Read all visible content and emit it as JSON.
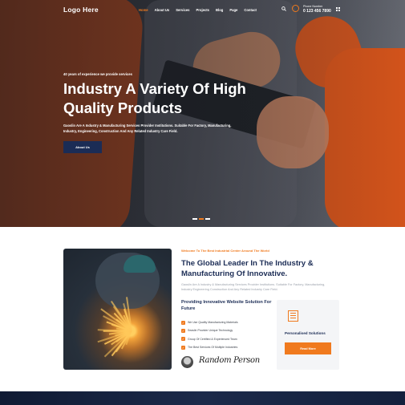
{
  "header": {
    "logo": "Logo Here",
    "nav": [
      "Home",
      "About Us",
      "Services",
      "Projects",
      "Blog",
      "Page",
      "Contact"
    ],
    "active_nav": "Home",
    "phone_label": "Phone Number",
    "phone_number": "0 123 456 7890"
  },
  "hero": {
    "eyebrow": "40 years of experience we provide services",
    "title": "Industry A Variety Of High Quality Products",
    "description": "Gaoslin Are A Industry & Manufacturing Services Provider Institutions. Suitable For Factory, Manufacturing, Industry, Engineering, Construction And Any Related Industry Care Field.",
    "button": "About Us",
    "slides": 3,
    "active_slide": 2
  },
  "about": {
    "welcome": "Welcome To The Best Industrial Center Around The World",
    "title": "The Global Leader In The Industry & Manufacturing Of Innovative.",
    "description": "Gaoslin Are A Industry & Manufacturing Services Provider Institutions. Suitable For Factory, Manufacturing, Industry Engineering Construction And Any Related Industry Care Field.",
    "subtitle": "Providing Innovative Website Solution For Future",
    "checklist": [
      "We Use Quality Manufacturing Materials",
      "Seaslin Provider Unique Technology",
      "Group Of Certified & Experienced Team",
      "The Best Services Of Multiple Industries"
    ],
    "signature": "Random Person",
    "card": {
      "label": "Personalised Solutions",
      "button": "Read More"
    }
  },
  "colors": {
    "accent": "#f07a1e",
    "navy": "#1b2c55"
  }
}
